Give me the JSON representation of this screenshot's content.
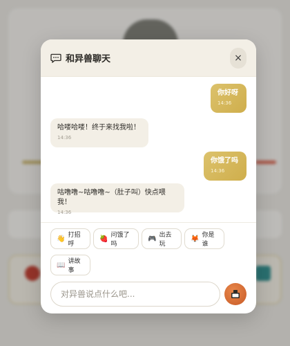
{
  "dialog": {
    "title": "和异兽聊天",
    "close_symbol": "×"
  },
  "messages": [
    {
      "role": "user",
      "text": "你好呀",
      "time": "14:36"
    },
    {
      "role": "bot",
      "text": "哈喽哈喽！终于来找我啦！",
      "time": "14:36"
    },
    {
      "role": "user",
      "text": "你饿了吗",
      "time": "14:36"
    },
    {
      "role": "bot",
      "text": "咕噜噜~咕噜噜~（肚子叫）快点喂我！",
      "time": "14:36"
    }
  ],
  "quick_replies": [
    {
      "icon": "👋",
      "label": "打招呼"
    },
    {
      "icon": "🍓",
      "label": "问饿了吗"
    },
    {
      "icon": "🎮",
      "label": "出去玩"
    },
    {
      "icon": "🦊",
      "label": "你是谁"
    },
    {
      "icon": "📖",
      "label": "讲故事"
    }
  ],
  "composer": {
    "placeholder": "对异兽说点什么吧..."
  },
  "colors": {
    "accent": "#d4b55a",
    "send": "#d96b34",
    "header_bg": "#f3efe6"
  }
}
